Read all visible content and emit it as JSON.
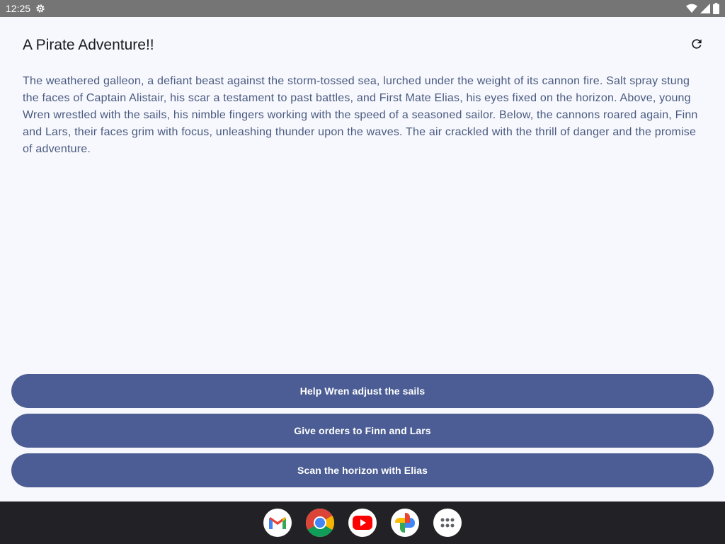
{
  "status_bar": {
    "time": "12:25",
    "icons": [
      "settings-icon",
      "wifi-icon",
      "signal-icon",
      "battery-icon"
    ]
  },
  "app": {
    "title": "A Pirate Adventure!!",
    "refresh_icon": "refresh-icon",
    "story": "The weathered galleon, a defiant beast against the storm-tossed sea, lurched under the weight of its cannon fire. Salt spray stung the faces of Captain Alistair, his scar a testament to past battles, and First Mate Elias, his eyes fixed on the horizon. Above, young Wren wrestled with the sails, his nimble fingers working with the speed of a seasoned sailor. Below, the cannons roared again, Finn and Lars, their faces grim with focus, unleashing thunder upon the waves.  The air crackled with the thrill of danger and the promise of adventure.",
    "choices": [
      {
        "label": "Help Wren adjust the sails"
      },
      {
        "label": "Give orders to Finn and Lars"
      },
      {
        "label": "Scan the horizon with Elias"
      }
    ]
  },
  "taskbar": {
    "apps": [
      "gmail-icon",
      "chrome-icon",
      "youtube-icon",
      "photos-icon",
      "app-drawer-icon"
    ]
  },
  "colors": {
    "status_bar": "#757575",
    "background": "#f7f8fd",
    "button": "#4b5d94",
    "story_text": "#4a5a80",
    "taskbar": "#222226"
  }
}
